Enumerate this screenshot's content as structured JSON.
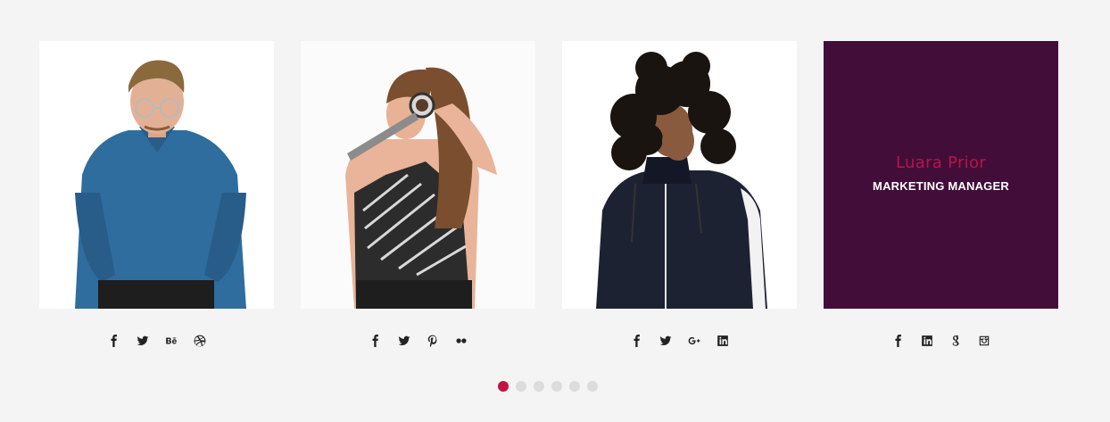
{
  "members": [
    {
      "photo": "man-blue-shirt-glasses-photo",
      "social": [
        "facebook-icon",
        "twitter-icon",
        "behance-icon",
        "dribbble-icon"
      ]
    },
    {
      "photo": "woman-magnifying-glass-photo",
      "social": [
        "facebook-icon",
        "twitter-icon",
        "pinterest-icon",
        "flickr-icon"
      ]
    },
    {
      "photo": "man-curly-hair-jacket-photo",
      "social": [
        "facebook-icon",
        "twitter-icon",
        "google-plus-icon",
        "linkedin-icon"
      ]
    },
    {
      "name": "Luara Prior",
      "role": "MARKETING MANAGER",
      "social": [
        "facebook-icon",
        "linkedin-icon",
        "google-icon",
        "instagram-icon"
      ]
    }
  ],
  "pagination": {
    "count": 6,
    "active": 1
  },
  "colors": {
    "background": "#f4f4f4",
    "hover_overlay": "#430d39",
    "accent": "#c4123f",
    "name": "#b8144a"
  }
}
